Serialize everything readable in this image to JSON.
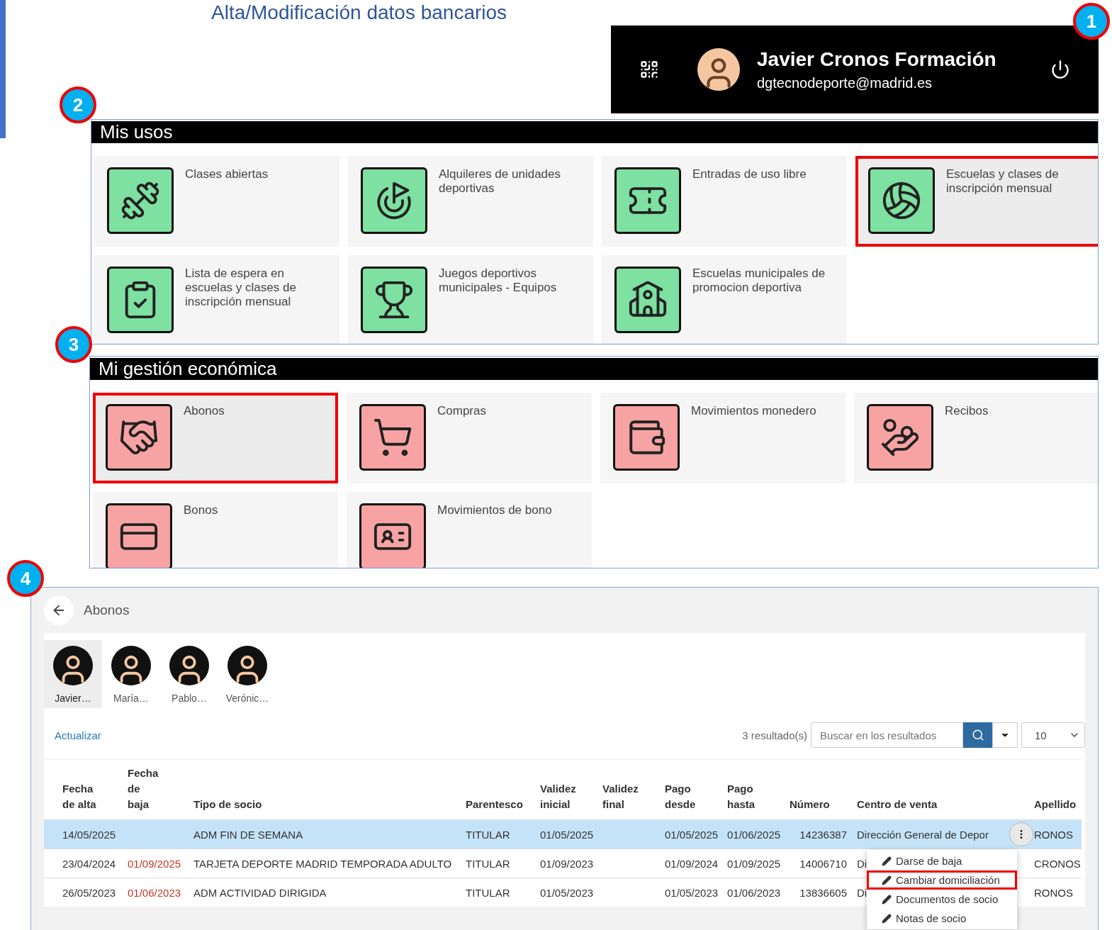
{
  "page_title": "Alta/Modificación datos bancarios",
  "user": {
    "name": "Javier Cronos Formación",
    "email": "dgtecnodeporte@madrid.es"
  },
  "callouts": [
    {
      "label": "1"
    },
    {
      "label": "2"
    },
    {
      "label": "3"
    },
    {
      "label": "4"
    }
  ],
  "sections": [
    {
      "title": "Mis usos",
      "tiles": [
        {
          "label": "Clases abiertas",
          "highlighted": false
        },
        {
          "label": "Alquileres de unidades deportivas",
          "highlighted": false
        },
        {
          "label": "Entradas de uso libre",
          "highlighted": false
        },
        {
          "label": "Escuelas y clases de inscripción mensual",
          "highlighted": true
        },
        {
          "label": "Lista de espera en escuelas y clases de inscripción mensual",
          "highlighted": false
        },
        {
          "label": "Juegos deportivos municipales - Equipos",
          "highlighted": false
        },
        {
          "label": "Escuelas municipales de promocion deportiva",
          "highlighted": false
        }
      ]
    },
    {
      "title": "Mi gestión económica",
      "tiles": [
        {
          "label": "Abonos",
          "highlighted": true
        },
        {
          "label": "Compras",
          "highlighted": false
        },
        {
          "label": "Movimientos monedero",
          "highlighted": false
        },
        {
          "label": "Recibos",
          "highlighted": false
        },
        {
          "label": "Bonos",
          "highlighted": false
        },
        {
          "label": "Movimientos de bono",
          "highlighted": false
        }
      ]
    }
  ],
  "abonos": {
    "title": "Abonos",
    "members": [
      {
        "name": "Javier…",
        "selected": true
      },
      {
        "name": "María…",
        "selected": false
      },
      {
        "name": "Pablo…",
        "selected": false
      },
      {
        "name": "Verónic…",
        "selected": false
      }
    ],
    "refresh": "Actualizar",
    "results": "3 resultado(s)",
    "search": {
      "placeholder": "Buscar en los resultados"
    },
    "page_size": "10",
    "columns": [
      "Fecha de alta",
      "Fecha de baja",
      "Tipo de socio",
      "Parentesco",
      "Validez inicial",
      "Validez final",
      "Pago desde",
      "Pago hasta",
      "Número",
      "Centro de venta",
      "Apellido"
    ],
    "rows": [
      {
        "selected": true,
        "menu_open": true,
        "cells": [
          "14/05/2025",
          "",
          "ADM FIN DE SEMANA",
          "TITULAR",
          "01/05/2025",
          "",
          "01/05/2025",
          "01/06/2025",
          "14236387",
          "Dirección General de Depor",
          "RONOS"
        ]
      },
      {
        "selected": false,
        "menu_open": false,
        "cells": [
          "23/04/2024",
          "01/09/2025",
          "TARJETA DEPORTE MADRID TEMPORADA ADULTO",
          "TITULAR",
          "01/09/2023",
          "",
          "01/09/2024",
          "01/09/2025",
          "14006710",
          "Di",
          "CRONOS"
        ]
      },
      {
        "selected": false,
        "menu_open": false,
        "cells": [
          "26/05/2023",
          "01/06/2023",
          "ADM ACTIVIDAD DIRIGIDA",
          "TITULAR",
          "01/05/2023",
          "",
          "01/05/2023",
          "01/06/2023",
          "13836605",
          "Di",
          "RONOS"
        ]
      }
    ],
    "menu": [
      {
        "label": "Darse de baja",
        "highlighted": false
      },
      {
        "label": "Cambiar domiciliación",
        "highlighted": true
      },
      {
        "label": "Documentos de socio",
        "highlighted": false
      },
      {
        "label": "Notas de socio",
        "highlighted": false
      }
    ]
  }
}
